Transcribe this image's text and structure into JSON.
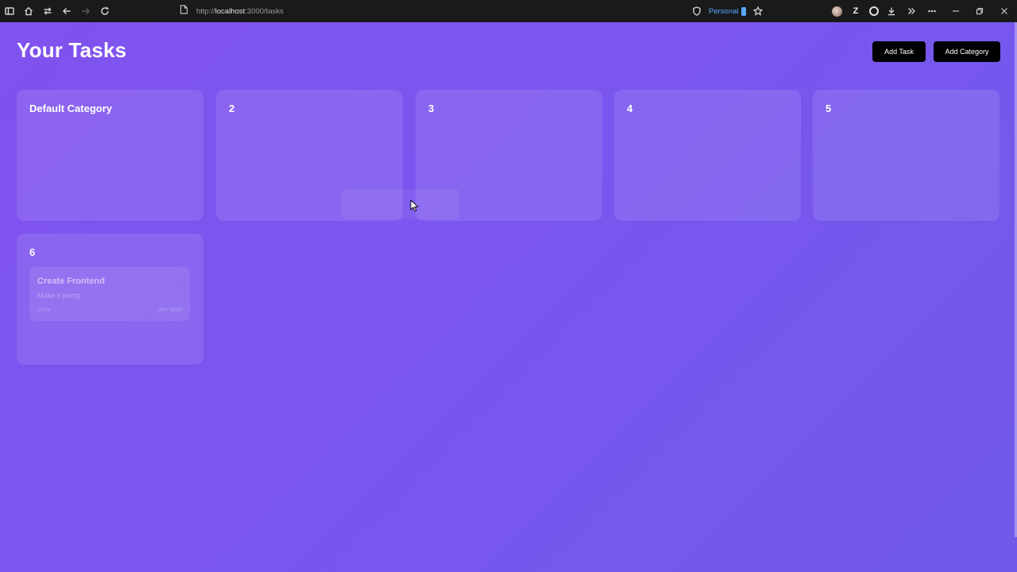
{
  "browser": {
    "url_scheme": "http://",
    "url_host": "localhost",
    "url_path": ":3000/tasks",
    "profile_label": "Personal",
    "icons": {
      "sidebar": "sidebar-icon",
      "home": "home-icon",
      "sync": "sync-icon",
      "back": "back-icon",
      "forward": "forward-icon",
      "reload": "reload-icon",
      "page": "page-icon",
      "shield": "shield-icon",
      "star": "star-icon",
      "avatar": "avatar-extension-icon",
      "z": "z-extension-icon",
      "g": "g-extension-icon",
      "download": "download-icon",
      "more_tools": "chevrons-right-icon",
      "menu": "more-icon",
      "minimize": "minimize-icon",
      "maximize": "restore-icon",
      "close": "close-icon"
    }
  },
  "page": {
    "title": "Your Tasks",
    "buttons": {
      "add_task": "Add Task",
      "add_category": "Add Category"
    },
    "categories": [
      {
        "title": "Default Category",
        "tasks": []
      },
      {
        "title": "2",
        "tasks": []
      },
      {
        "title": "3",
        "tasks": []
      },
      {
        "title": "4",
        "tasks": []
      },
      {
        "title": "5",
        "tasks": []
      },
      {
        "title": "6",
        "tasks": [
          {
            "title": "Create Frontend",
            "description": "Make it pretty",
            "status": "Done",
            "category": "Dev Work"
          }
        ]
      }
    ]
  },
  "colors": {
    "background_start": "#8052ee",
    "background_end": "#7159ea",
    "button_bg": "#000000",
    "text": "#ffffff",
    "profile_accent": "#5aa7ff"
  }
}
